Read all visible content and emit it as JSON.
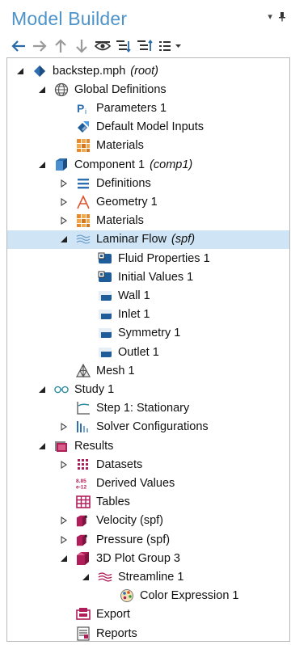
{
  "panel": {
    "title": "Model Builder",
    "title_controls": "▾ ■"
  },
  "toolbar": {
    "items": [
      "back-arrow-icon",
      "forward-arrow-icon",
      "up-arrow-icon",
      "down-arrow-icon",
      "eye-icon",
      "expand-all-icon",
      "collapse-all-icon",
      "list-menu-icon"
    ]
  },
  "tree": {
    "nodes": [
      {
        "label": "backstep.mph",
        "tag": "(root)",
        "icon": "model-file-icon",
        "expander": "expanded"
      },
      {
        "label": "Global Definitions",
        "tag": "",
        "icon": "globe-icon",
        "expander": "expanded"
      },
      {
        "label": "Parameters 1",
        "tag": "",
        "icon": "parameters-icon",
        "expander": "none"
      },
      {
        "label": "Default Model Inputs",
        "tag": "",
        "icon": "model-inputs-icon",
        "expander": "none"
      },
      {
        "label": "Materials",
        "tag": "",
        "icon": "materials-icon",
        "expander": "none"
      },
      {
        "label": "Component 1",
        "tag": "(comp1)",
        "icon": "component-icon",
        "expander": "expanded"
      },
      {
        "label": "Definitions",
        "tag": "",
        "icon": "definitions-icon",
        "expander": "collapsed"
      },
      {
        "label": "Geometry 1",
        "tag": "",
        "icon": "geometry-icon",
        "expander": "collapsed"
      },
      {
        "label": "Materials",
        "tag": "",
        "icon": "materials-icon",
        "expander": "collapsed"
      },
      {
        "label": "Laminar Flow",
        "tag": "(spf)",
        "icon": "laminar-flow-icon",
        "expander": "expanded",
        "selected": true
      },
      {
        "label": "Fluid Properties 1",
        "tag": "",
        "icon": "domain-feature-icon",
        "expander": "none"
      },
      {
        "label": "Initial Values 1",
        "tag": "",
        "icon": "domain-feature-icon",
        "expander": "none"
      },
      {
        "label": "Wall 1",
        "tag": "",
        "icon": "boundary-feature-icon",
        "expander": "none"
      },
      {
        "label": "Inlet 1",
        "tag": "",
        "icon": "boundary-feature-icon",
        "expander": "none"
      },
      {
        "label": "Symmetry 1",
        "tag": "",
        "icon": "boundary-feature-icon",
        "expander": "none"
      },
      {
        "label": "Outlet 1",
        "tag": "",
        "icon": "boundary-feature-icon",
        "expander": "none"
      },
      {
        "label": "Mesh 1",
        "tag": "",
        "icon": "mesh-icon",
        "expander": "none"
      },
      {
        "label": "Study 1",
        "tag": "",
        "icon": "study-icon",
        "expander": "expanded"
      },
      {
        "label": "Step 1: Stationary",
        "tag": "",
        "icon": "stationary-step-icon",
        "expander": "none"
      },
      {
        "label": "Solver Configurations",
        "tag": "",
        "icon": "solver-icon",
        "expander": "collapsed"
      },
      {
        "label": "Results",
        "tag": "",
        "icon": "results-icon",
        "expander": "expanded"
      },
      {
        "label": "Datasets",
        "tag": "",
        "icon": "datasets-icon",
        "expander": "collapsed"
      },
      {
        "label": "Derived Values",
        "tag": "",
        "icon": "derived-values-icon",
        "expander": "none"
      },
      {
        "label": "Tables",
        "tag": "",
        "icon": "tables-icon",
        "expander": "none"
      },
      {
        "label": "Velocity (spf)",
        "tag": "",
        "icon": "plot-group-icon",
        "expander": "collapsed"
      },
      {
        "label": "Pressure (spf)",
        "tag": "",
        "icon": "plot-group-icon",
        "expander": "collapsed"
      },
      {
        "label": "3D Plot Group 3",
        "tag": "",
        "icon": "plot-group-3d-icon",
        "expander": "expanded"
      },
      {
        "label": "Streamline 1",
        "tag": "",
        "icon": "streamline-icon",
        "expander": "expanded"
      },
      {
        "label": "Color Expression 1",
        "tag": "",
        "icon": "color-expression-icon",
        "expander": "none"
      },
      {
        "label": "Export",
        "tag": "",
        "icon": "export-icon",
        "expander": "none"
      },
      {
        "label": "Reports",
        "tag": "",
        "icon": "reports-icon",
        "expander": "none"
      }
    ]
  },
  "icon_glyphs": {
    "derived_values_top": "8.85",
    "derived_values_bottom": "e-12",
    "parameters_letter": "P",
    "parameters_sub": "i"
  },
  "colors": {
    "title": "#4e93c9",
    "selection": "#cfe5f6",
    "blue": "#1f5d9a",
    "light_blue": "#4a8fd0",
    "orange": "#e8892b",
    "magenta": "#b01e5a",
    "gray": "#6b6b6b"
  }
}
